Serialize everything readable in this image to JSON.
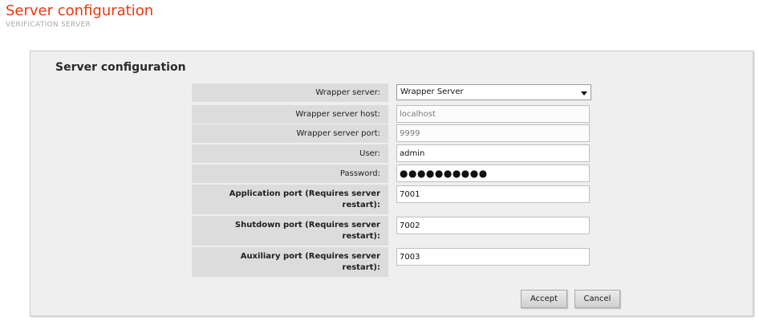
{
  "header": {
    "title": "Server configuration",
    "subtitle": "VERIFICATION SERVER"
  },
  "panel": {
    "heading": "Server configuration"
  },
  "form": {
    "wrapper_server": {
      "label": "Wrapper server:",
      "value": "Wrapper Server"
    },
    "wrapper_server_host": {
      "label": "Wrapper server host:",
      "value": "localhost"
    },
    "wrapper_server_port": {
      "label": "Wrapper server port:",
      "value": "9999"
    },
    "user": {
      "label": "User:",
      "value": "admin"
    },
    "password": {
      "label": "Password:",
      "value": "●●●●●●●●●●"
    },
    "application_port": {
      "label": "Application port (Requires server restart):",
      "value": "7001"
    },
    "shutdown_port": {
      "label": "Shutdown port (Requires server restart):",
      "value": "7002"
    },
    "auxiliary_port": {
      "label": "Auxiliary port (Requires server restart):",
      "value": "7003"
    }
  },
  "actions": {
    "accept_label": "Accept",
    "cancel_label": "Cancel"
  },
  "colors": {
    "title": "#e8390d",
    "panel_bg": "#efefef",
    "label_bg": "#dcdcdc"
  }
}
